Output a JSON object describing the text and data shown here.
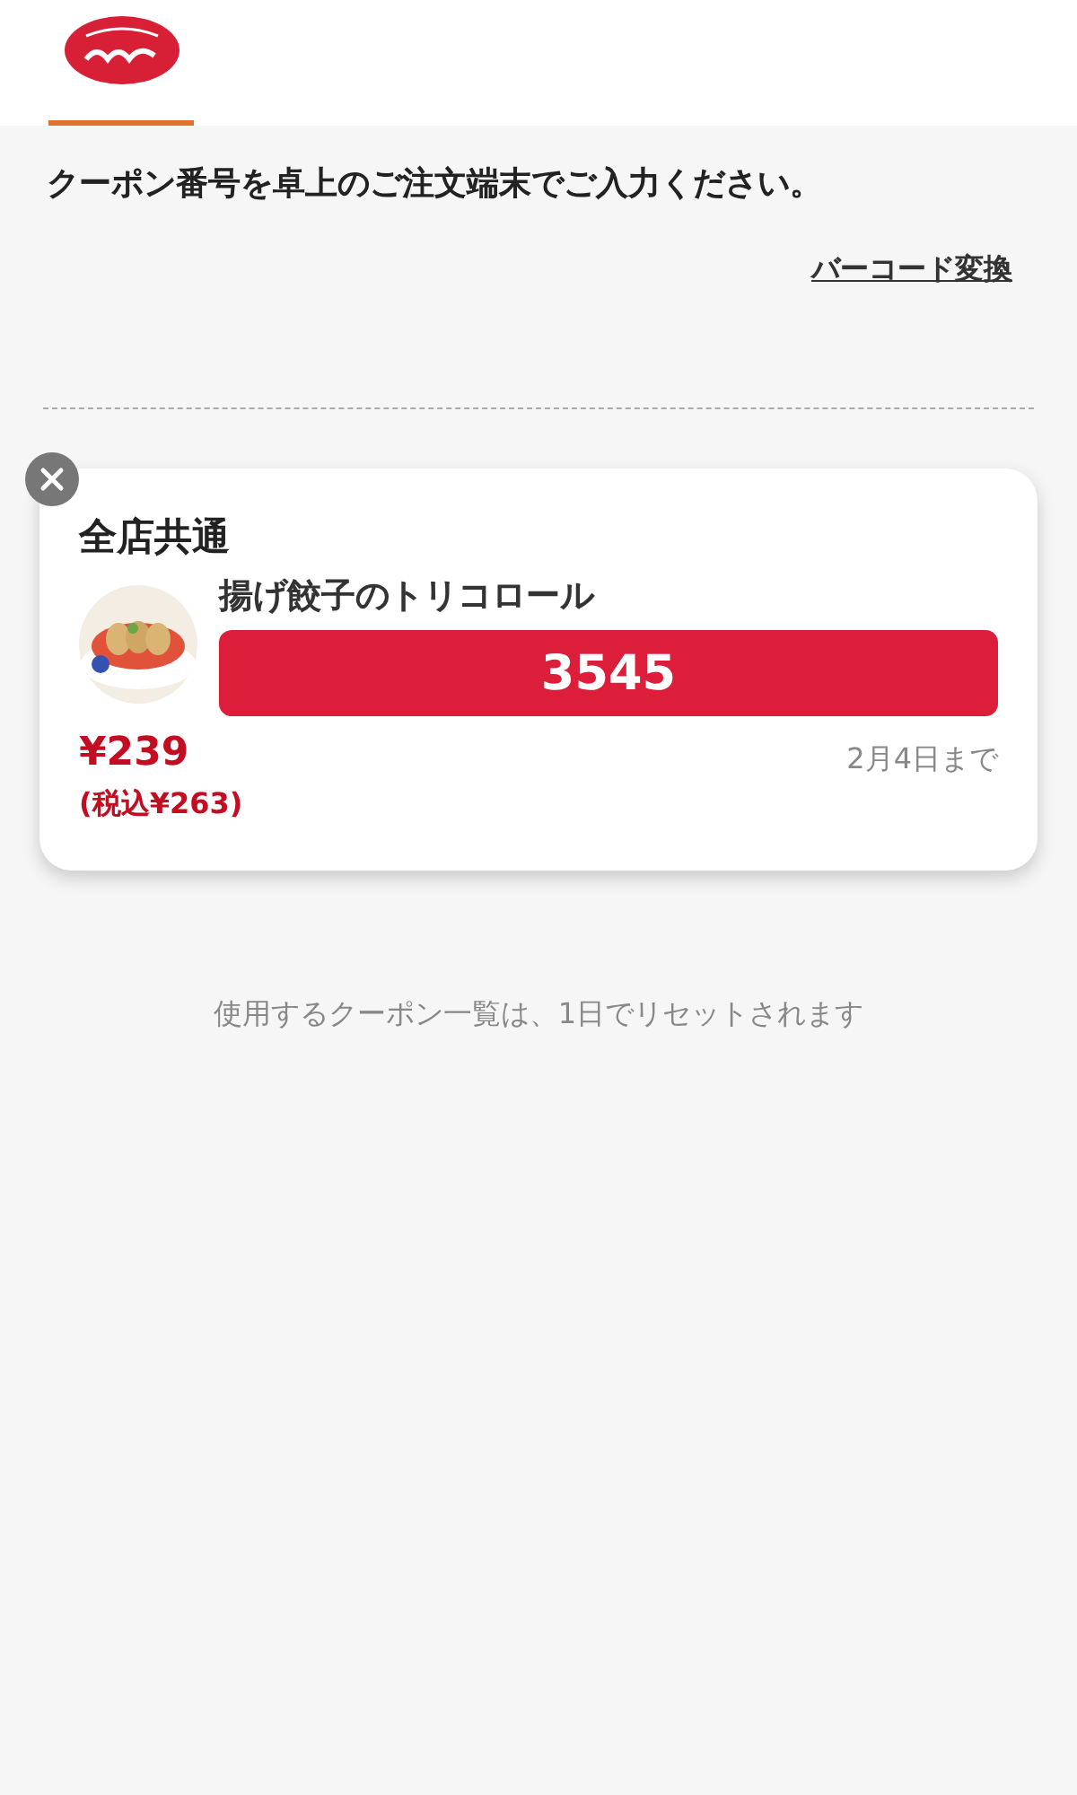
{
  "header": {
    "tab_selected": true
  },
  "instruction": "クーポン番号を卓上のご注文端末でご入力ください。",
  "barcode_link": "バーコード変換",
  "coupon": {
    "scope": "全店共通",
    "name": "揚げ餃子のトリコロール",
    "code": "3545",
    "price": "¥239",
    "price_with_tax": "(税込¥263)",
    "expiry": "2月4日まで"
  },
  "footer_note": "使用するクーポン一覧は、1日でリセットされます"
}
